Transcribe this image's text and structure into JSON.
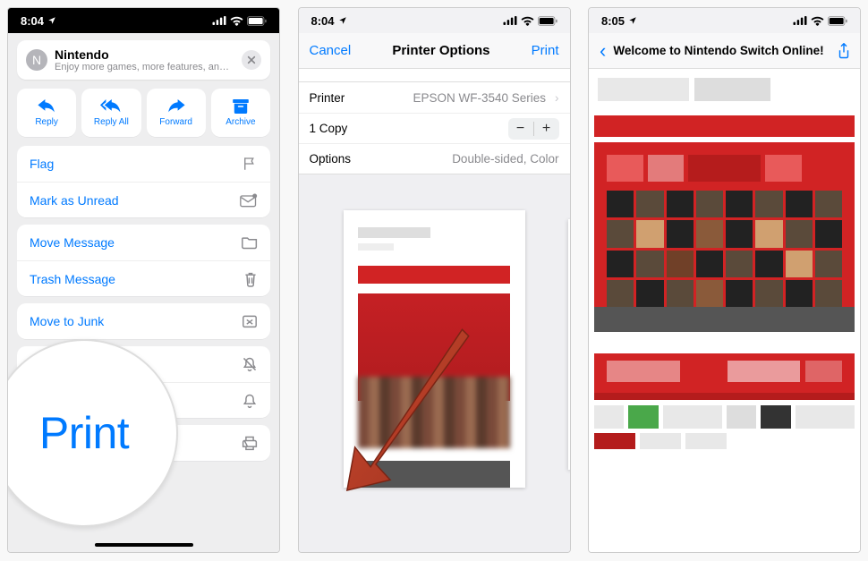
{
  "status_time_1": "8:04",
  "status_time_2": "8:04",
  "status_time_3": "8:05",
  "phone1": {
    "banner_avatar_letter": "N",
    "banner_title": "Nintendo",
    "banner_subtitle": "Enjoy more games, more features, and mo…",
    "actions": {
      "reply": "Reply",
      "reply_all": "Reply All",
      "forward": "Forward",
      "archive": "Archive"
    },
    "rows": {
      "flag": "Flag",
      "mark_unread": "Mark as Unread",
      "move_message": "Move Message",
      "trash_message": "Trash Message",
      "move_junk": "Move to Junk"
    },
    "bubble_label": "Print"
  },
  "phone2": {
    "nav_cancel": "Cancel",
    "nav_title": "Printer Options",
    "nav_print": "Print",
    "row_printer_k": "Printer",
    "row_printer_v": "EPSON WF-3540 Series",
    "row_copy_k": "1 Copy",
    "row_options_k": "Options",
    "row_options_v": "Double-sided, Color"
  },
  "phone3": {
    "nav_title": "Welcome to Nintendo Switch Online!"
  }
}
